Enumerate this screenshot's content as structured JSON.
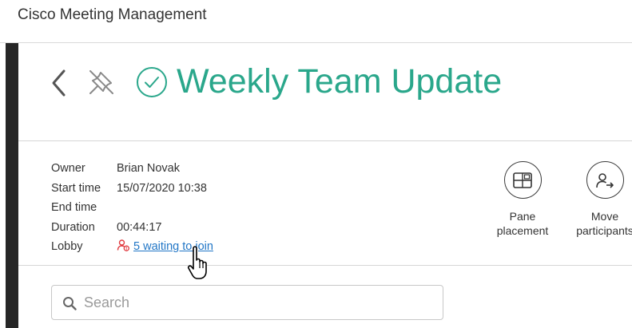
{
  "app": {
    "title": "Cisco Meeting Management"
  },
  "meeting": {
    "title": "Weekly Team Update",
    "status": "active",
    "status_color": "#2aa78b"
  },
  "details": {
    "owner": {
      "label": "Owner",
      "value": "Brian Novak"
    },
    "start_time": {
      "label": "Start time",
      "value": "15/07/2020 10:38"
    },
    "end_time": {
      "label": "End time",
      "value": ""
    },
    "duration": {
      "label": "Duration",
      "value": "00:44:17"
    },
    "lobby": {
      "label": "Lobby",
      "value": "5 waiting to join",
      "icon": "person-alert-icon",
      "icon_color": "#e0393e",
      "link_color": "#2176c6"
    }
  },
  "actions": {
    "pane_placement": {
      "label_line1": "Pane",
      "label_line2": "placement",
      "icon": "pane-placement-icon"
    },
    "move_participants": {
      "label_line1": "Move",
      "label_line2": "participants",
      "icon": "move-participants-icon"
    }
  },
  "search": {
    "placeholder": "Search",
    "value": "",
    "icon": "search-icon"
  },
  "icons": {
    "back": "chevron-left-icon",
    "pin": "pin-icon",
    "status": "check-circle-icon",
    "cursor": "hand-pointer-cursor"
  }
}
